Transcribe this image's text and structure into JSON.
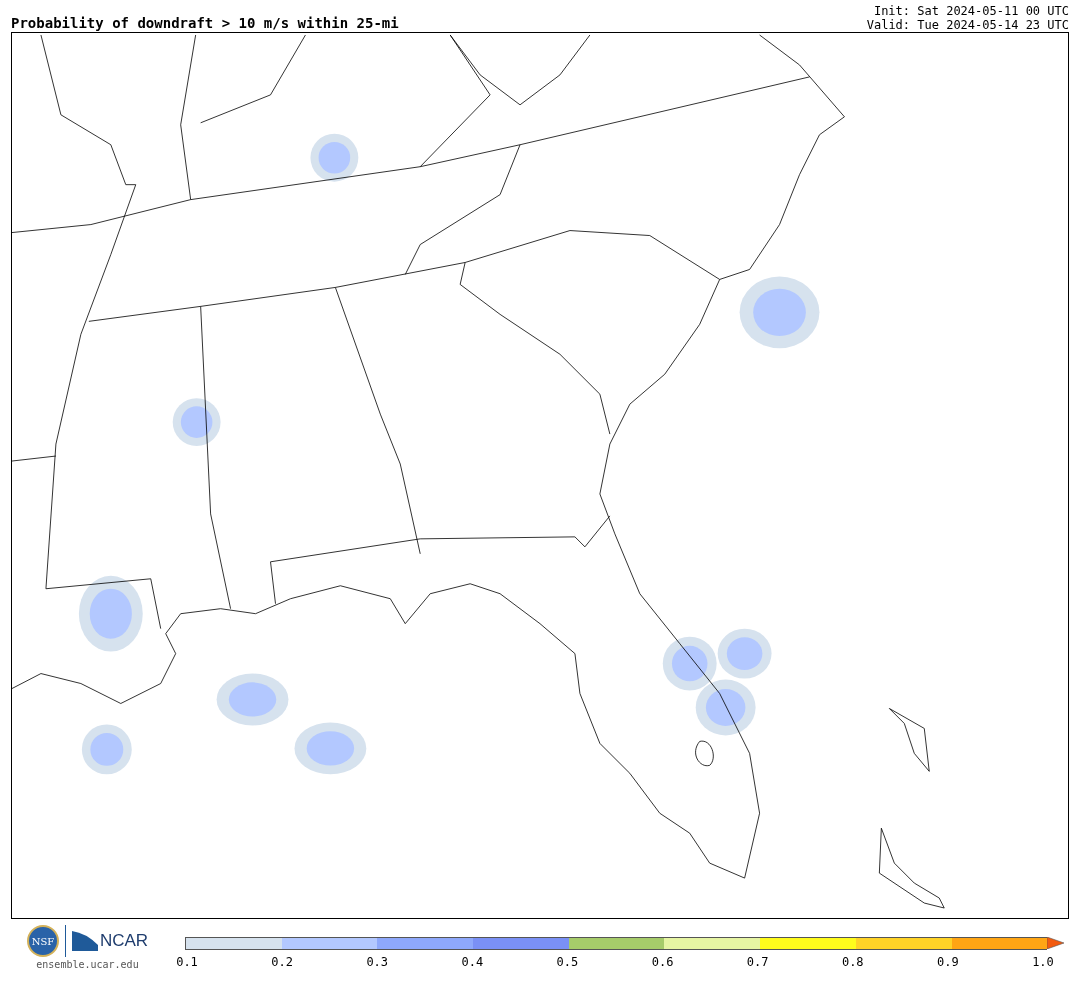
{
  "title": "Probability of downdraft > 10 m/s within 25-mi",
  "init": "Init: Sat 2024-05-11 00 UTC",
  "valid": "Valid: Tue 2024-05-14 23 UTC",
  "logos": {
    "nsf": "NSF",
    "ncar": "NCAR"
  },
  "site": "ensemble.ucar.edu",
  "colorbar": {
    "segments": [
      {
        "color": "#d6e2ee"
      },
      {
        "color": "#b3c8ff"
      },
      {
        "color": "#8ea8fb"
      },
      {
        "color": "#7a90f5"
      },
      {
        "color": "#a6cc6a"
      },
      {
        "color": "#e6f5a3"
      },
      {
        "color": "#fffc1c"
      },
      {
        "color": "#ffd327"
      },
      {
        "color": "#ffa514"
      }
    ],
    "extension": {
      "color": "#f25a0f"
    },
    "ticks": [
      "0.1",
      "0.2",
      "0.3",
      "0.4",
      "0.5",
      "0.6",
      "0.7",
      "0.8",
      "0.9",
      "1.0"
    ]
  }
}
